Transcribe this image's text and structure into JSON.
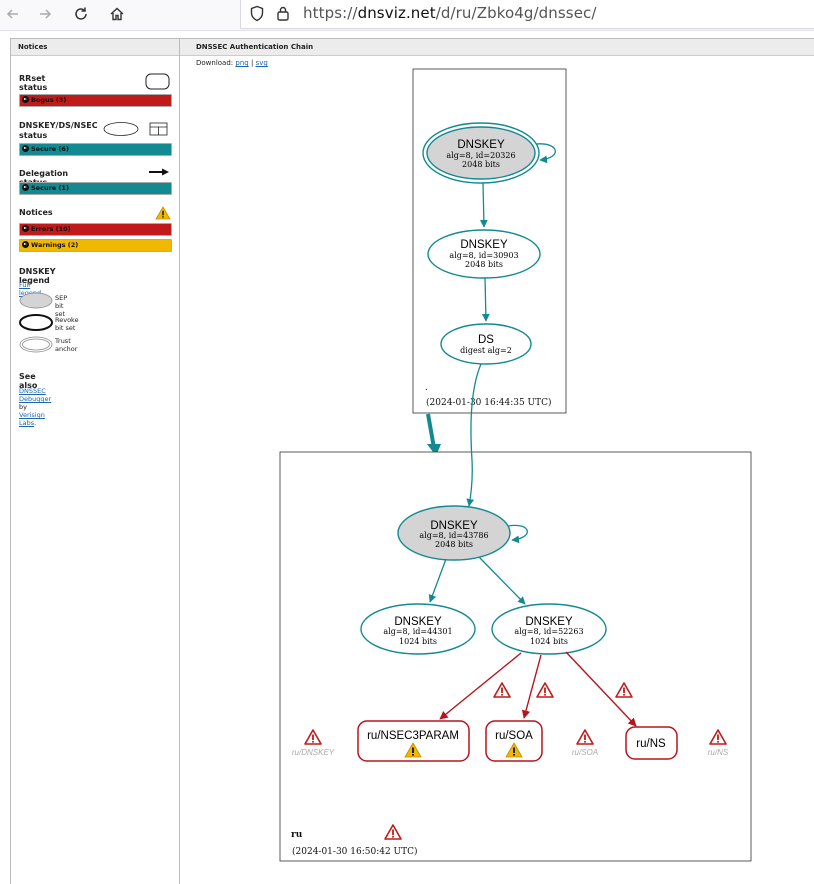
{
  "browser": {
    "url_prefix": "https://",
    "url_domain": "dnsviz.net",
    "url_path": "/d/ru/Zbko4g/dnssec/"
  },
  "headers": {
    "notices": "Notices",
    "chain": "DNSSEC Authentication Chain"
  },
  "download": {
    "label": "Download:",
    "png": "png",
    "sep": "|",
    "svg": "svg"
  },
  "notices": {
    "rrset_title": "RRset status",
    "rrset_items": [
      {
        "label": "Bogus (3)",
        "color": "#c11a1a"
      }
    ],
    "dnskey_title_1": "DNSKEY/DS/NSEC",
    "dnskey_title_2": "status",
    "dnskey_items": [
      {
        "label": "Secure (6)",
        "color": "#138a92"
      }
    ],
    "delegation_title": "Delegation status",
    "delegation_items": [
      {
        "label": "Secure (1)",
        "color": "#138a92"
      }
    ],
    "notices_title": "Notices",
    "notice_items": [
      {
        "label": "Errors (10)",
        "color": "#c11a1a"
      },
      {
        "label": "Warnings (2)",
        "color": "#f1b800"
      }
    ],
    "legend_title": "DNSKEY legend",
    "full_legend": "Full legend",
    "legend_items": [
      "SEP bit set",
      "Revoke bit set",
      "Trust anchor"
    ],
    "see_also_title": "See also",
    "see_also_link1": "DNSSEC Debugger",
    "see_also_by": "by",
    "see_also_link2": "Verisign Labs",
    "see_also_end": "."
  },
  "graph": {
    "root_zone": {
      "label": ".",
      "timestamp": "(2024-01-30 16:44:35 UTC)",
      "ksk": {
        "title": "DNSKEY",
        "line1": "alg=8, id=20326",
        "line2": "2048 bits"
      },
      "zsk": {
        "title": "DNSKEY",
        "line1": "alg=8, id=30903",
        "line2": "2048 bits"
      },
      "ds": {
        "title": "DS",
        "line1": "digest alg=2"
      }
    },
    "ru_zone": {
      "label": "ru",
      "timestamp": "(2024-01-30 16:50:42 UTC)",
      "ksk": {
        "title": "DNSKEY",
        "line1": "alg=8, id=43786",
        "line2": "2048 bits"
      },
      "zsk1": {
        "title": "DNSKEY",
        "line1": "alg=8, id=44301",
        "line2": "1024 bits"
      },
      "zsk2": {
        "title": "DNSKEY",
        "line1": "alg=8, id=52263",
        "line2": "1024 bits"
      },
      "rr_nsec3param": "ru/NSEC3PARAM",
      "rr_soa": "ru/SOA",
      "rr_ns": "ru/NS",
      "ghost_dnskey": "ru/DNSKEY",
      "ghost_soa": "ru/SOA",
      "ghost_ns": "ru/NS"
    },
    "colors": {
      "secure": "#138a92",
      "bogus": "#b3161c",
      "sep_fill": "#d4d4d4",
      "warning": "#f1b800",
      "error": "#c11a1a"
    }
  }
}
